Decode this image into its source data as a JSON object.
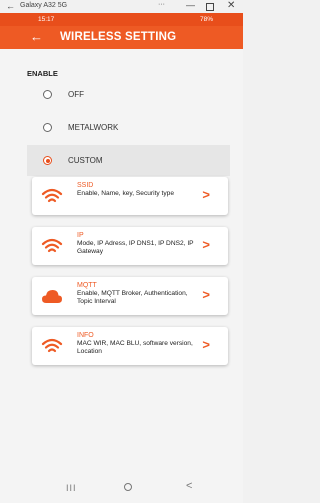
{
  "window": {
    "title": "Galaxy A32 5G",
    "dots": "···",
    "min": "—",
    "close": "✕",
    "back": "←"
  },
  "status": {
    "time": "15:17",
    "battery": "78%"
  },
  "header": {
    "back_icon": "←",
    "title": "WIRELESS SETTING"
  },
  "enable": {
    "label": "ENABLE",
    "options": [
      "OFF",
      "METALWORK",
      "CUSTOM"
    ],
    "selected": "CUSTOM"
  },
  "cards": [
    {
      "title": "SSID",
      "desc": "Enable, Name, key, Security type",
      "icon": "wifi-icon"
    },
    {
      "title": "IP",
      "desc": "Mode, IP Adress, IP DNS1, IP DNS2, IP Gateway",
      "icon": "wifi-icon"
    },
    {
      "title": "MQTT",
      "desc": "Enable, MQTT Broker, Authentication, Topic Interval",
      "icon": "cloud-icon"
    },
    {
      "title": "INFO",
      "desc": "MAC WIR, MAC BLU, software version, Location",
      "icon": "wifi-icon"
    }
  ],
  "nav": {
    "recent": "III",
    "back": "<"
  },
  "colors": {
    "accent": "#ee5a24",
    "status_bar": "#e84e1b"
  }
}
